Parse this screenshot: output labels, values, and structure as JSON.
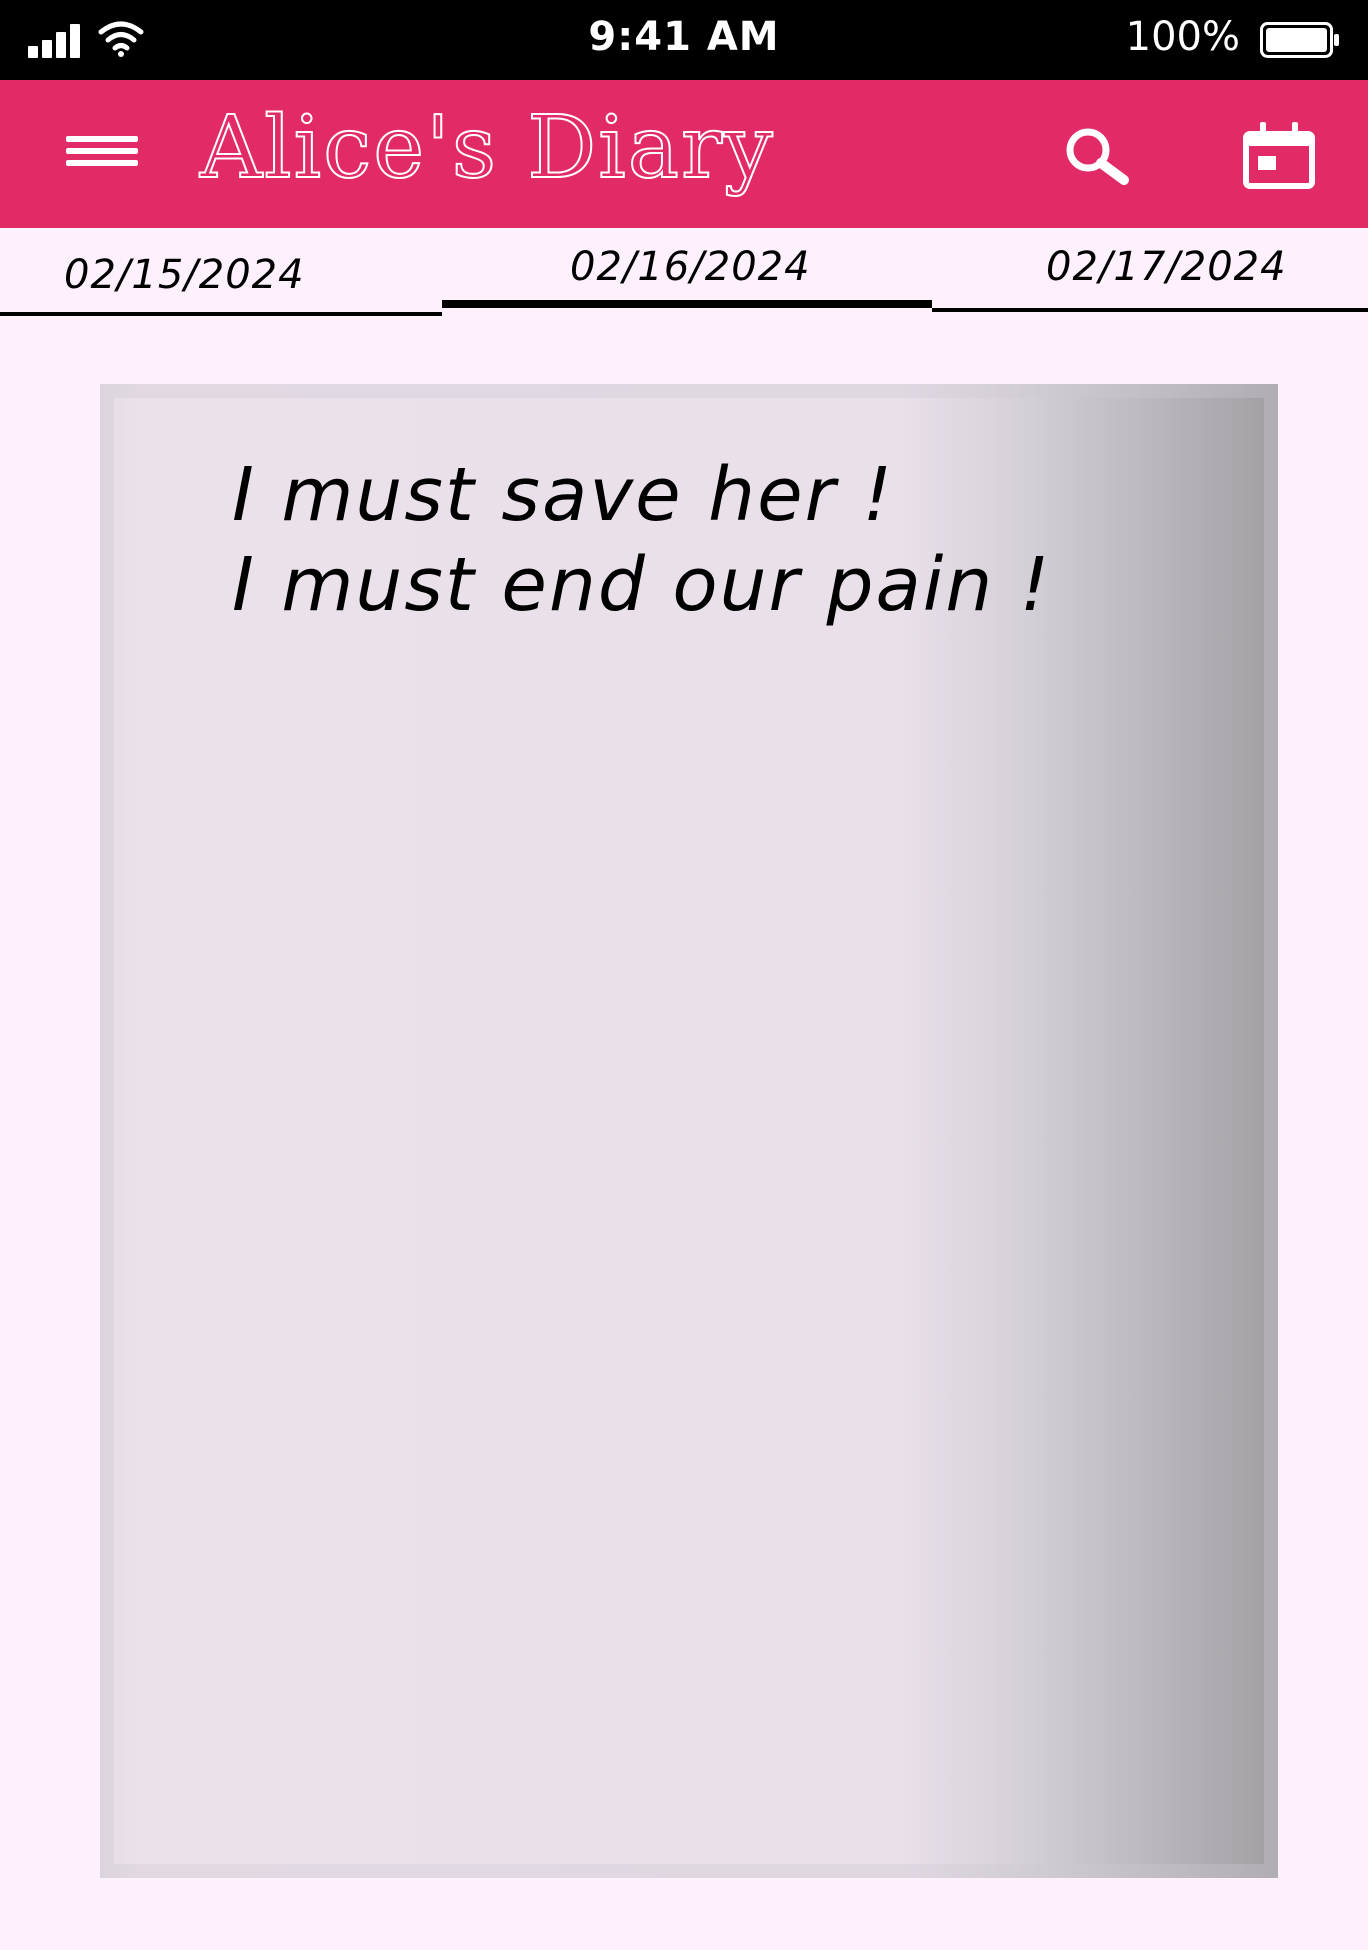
{
  "status_bar": {
    "time": "9:41 AM",
    "battery_percent": "100%",
    "battery_level": 1.0,
    "icons": [
      "signal-icon",
      "wifi-icon",
      "battery-icon"
    ]
  },
  "app_bar": {
    "title": "Alice's Diary",
    "accent_color": "#e22a66",
    "icons": [
      "menu-icon",
      "search-icon",
      "calendar-icon"
    ]
  },
  "date_tabs": {
    "tabs": [
      {
        "label": "02/15/2024"
      },
      {
        "label": "02/16/2024"
      },
      {
        "label": "02/17/2024"
      }
    ],
    "selected": "02/16/2024"
  },
  "diary_entry": {
    "lines": [
      "I must save her !",
      "I must end our pain !"
    ]
  }
}
